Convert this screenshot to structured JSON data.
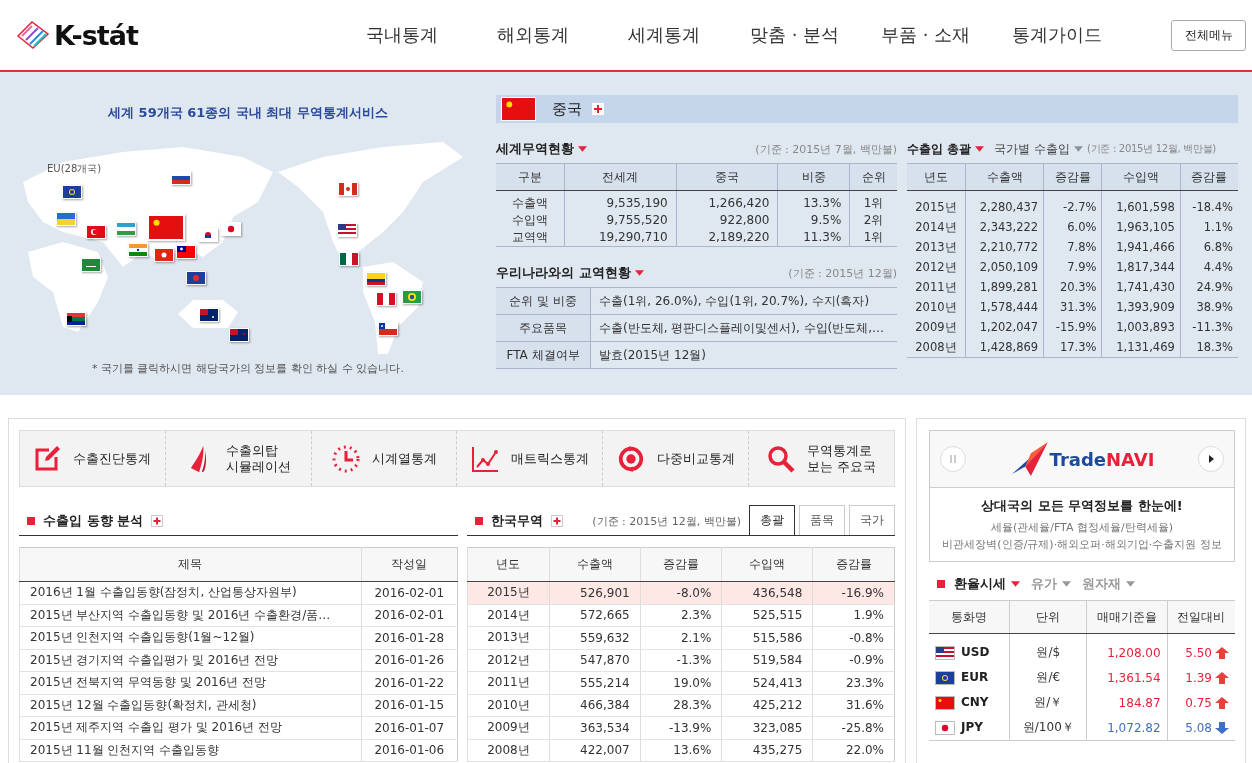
{
  "header": {
    "logo": "K-stát",
    "nav": [
      "국내통계",
      "해외통계",
      "세계통계",
      "맞춤 · 분석",
      "부품 · 소재",
      "통계가이드"
    ],
    "menu_button": "전체메뉴"
  },
  "map": {
    "headline": "세계 59개국 61종의 국내 최대 무역통계서비스",
    "eu_label": "EU(28개국)",
    "footnote": "* 국기를 클릭하시면 해당국가의 정보를 확인 하실 수 있습니다.",
    "flags": [
      {
        "selected": false
      },
      {
        "selected": false
      },
      {
        "selected": false
      },
      {
        "selected": false
      },
      {
        "selected": false
      },
      {
        "selected": false
      },
      {
        "selected": true
      },
      {
        "selected": false
      },
      {
        "selected": false
      },
      {
        "selected": false
      },
      {
        "selected": false
      },
      {
        "selected": false
      },
      {
        "selected": false
      },
      {
        "selected": false
      },
      {
        "selected": false
      },
      {
        "selected": false
      },
      {
        "selected": false
      },
      {
        "selected": false
      },
      {
        "selected": false
      },
      {
        "selected": false
      },
      {
        "selected": false
      },
      {
        "selected": false
      },
      {
        "selected": false
      }
    ]
  },
  "country": {
    "name": "중국"
  },
  "world_trade": {
    "title": "세계무역현황",
    "note": "(기준 : 2015년 7월, 백만불)",
    "columns": [
      "구분",
      "전세계",
      "중국",
      "비중",
      "순위"
    ],
    "rows": [
      [
        "수출액",
        "9,535,190",
        "1,266,420",
        "13.3%",
        "1위"
      ],
      [
        "수입액",
        "9,755,520",
        "922,800",
        "9.5%",
        "2위"
      ],
      [
        "교역액",
        "19,290,710",
        "2,189,220",
        "11.3%",
        "1위"
      ]
    ]
  },
  "korea_trade": {
    "title": "우리나라와의 교역현황",
    "note": "(기준 : 2015년 12월)",
    "rows": [
      {
        "label": "순위 및 비중",
        "value": "수출(1위, 26.0%), 수입(1위, 20.7%), 수지(흑자)"
      },
      {
        "label": "주요품목",
        "value": "수출(반도체, 평판디스플레이및센서), 수입(반도체,…"
      },
      {
        "label": "FTA 체결여부",
        "value": "발효(2015년 12월)"
      }
    ]
  },
  "trade_summary": {
    "tabs": [
      {
        "label": "수출입 총괄",
        "selected": true
      },
      {
        "label": "국가별 수출입",
        "selected": false
      }
    ],
    "note": "(기준 : 2015년 12월, 백만불)",
    "columns": [
      "년도",
      "수출액",
      "증감률",
      "수입액",
      "증감률"
    ],
    "rows": [
      [
        "2015년",
        "2,280,437",
        "-2.7%",
        "1,601,598",
        "-18.4%"
      ],
      [
        "2014년",
        "2,343,222",
        "6.0%",
        "1,963,105",
        "1.1%"
      ],
      [
        "2013년",
        "2,210,772",
        "7.8%",
        "1,941,466",
        "6.8%"
      ],
      [
        "2012년",
        "2,050,109",
        "7.9%",
        "1,817,344",
        "4.4%"
      ],
      [
        "2011년",
        "1,899,281",
        "20.3%",
        "1,741,430",
        "24.9%"
      ],
      [
        "2010년",
        "1,578,444",
        "31.3%",
        "1,393,909",
        "38.9%"
      ],
      [
        "2009년",
        "1,202,047",
        "-15.9%",
        "1,003,893",
        "-11.3%"
      ],
      [
        "2008년",
        "1,428,869",
        "17.3%",
        "1,131,469",
        "18.3%"
      ]
    ]
  },
  "tools": [
    {
      "kind": "edit",
      "label": "수출진단통계"
    },
    {
      "kind": "tower",
      "label": "수출의탑\n시뮬레이션"
    },
    {
      "kind": "clock",
      "label": "시계열통계"
    },
    {
      "kind": "chart",
      "label": "매트릭스통계"
    },
    {
      "kind": "target",
      "label": "다중비교통계"
    },
    {
      "kind": "search",
      "label": "무역통계로\n보는 주요국"
    }
  ],
  "trend": {
    "title": "수출입 동향 분석",
    "columns": [
      "제목",
      "작성일"
    ],
    "rows": [
      [
        "2016년 1월 수출입동향(잠정치, 산업통상자원부)",
        "2016-02-01"
      ],
      [
        "2015년 부산지역 수출입동향 및 2016년 수출환경/품…",
        "2016-02-01"
      ],
      [
        "2015년 인천지역 수출입동향(1월~12월)",
        "2016-01-28"
      ],
      [
        "2015년 경기지역 수출입평가 및 2016년 전망",
        "2016-01-26"
      ],
      [
        "2015년 전북지역 무역동향 및 2016년 전망",
        "2016-01-22"
      ],
      [
        "2015년 12월 수출입동향(확정치, 관세청)",
        "2016-01-15"
      ],
      [
        "2015년 제주지역 수출입 평가 및 2016년 전망",
        "2016-01-07"
      ],
      [
        "2015년 11월 인천지역 수출입동향",
        "2016-01-06"
      ]
    ]
  },
  "korea_stats": {
    "title": "한국무역",
    "note": "(기준 : 2015년 12월, 백만불)",
    "tabs": [
      {
        "label": "총괄",
        "selected": true
      },
      {
        "label": "품목",
        "selected": false
      },
      {
        "label": "국가",
        "selected": false
      }
    ],
    "columns": [
      "년도",
      "수출액",
      "증감률",
      "수입액",
      "증감률"
    ],
    "rows": [
      {
        "cells": [
          "2015년",
          "526,901",
          "-8.0%",
          "436,548",
          "-16.9%"
        ],
        "selected": true
      },
      {
        "cells": [
          "2014년",
          "572,665",
          "2.3%",
          "525,515",
          "1.9%"
        ],
        "selected": false
      },
      {
        "cells": [
          "2013년",
          "559,632",
          "2.1%",
          "515,586",
          "-0.8%"
        ],
        "selected": false
      },
      {
        "cells": [
          "2012년",
          "547,870",
          "-1.3%",
          "519,584",
          "-0.9%"
        ],
        "selected": false
      },
      {
        "cells": [
          "2011년",
          "555,214",
          "19.0%",
          "524,413",
          "23.3%"
        ],
        "selected": false
      },
      {
        "cells": [
          "2010년",
          "466,384",
          "28.3%",
          "425,212",
          "31.6%"
        ],
        "selected": false
      },
      {
        "cells": [
          "2009년",
          "363,534",
          "-13.9%",
          "323,085",
          "-25.8%"
        ],
        "selected": false
      },
      {
        "cells": [
          "2008년",
          "422,007",
          "13.6%",
          "435,275",
          "22.0%"
        ],
        "selected": false
      }
    ]
  },
  "tradenavi": {
    "logo_prefix": "Trade",
    "logo_suffix": "NAVI",
    "headline": "상대국의 모든 무역정보를 한눈에!",
    "lines": [
      "세율(관세율/FTA 협정세율/탄력세율)",
      "비관세장벽(인증/규제)·해외오퍼·해외기업·수출지원 정보"
    ]
  },
  "exchange": {
    "tabs": [
      {
        "label": "환율시세",
        "selected": true
      },
      {
        "label": "유가",
        "selected": false
      },
      {
        "label": "원자재",
        "selected": false
      }
    ],
    "columns": [
      "통화명",
      "단위",
      "매매기준율",
      "전일대비"
    ],
    "rows": [
      {
        "currency": "USD",
        "unit": "원/$",
        "rate": "1,208.00",
        "change": "5.50",
        "rising": true
      },
      {
        "currency": "EUR",
        "unit": "원/€",
        "rate": "1,361.54",
        "change": "1.39",
        "rising": true
      },
      {
        "currency": "CNY",
        "unit": "원/￥",
        "rate": "184.87",
        "change": "0.75",
        "rising": true
      },
      {
        "currency": "JPY",
        "unit": "원/100￥",
        "rate": "1,072.82",
        "change": "5.08",
        "rising": false
      }
    ]
  }
}
